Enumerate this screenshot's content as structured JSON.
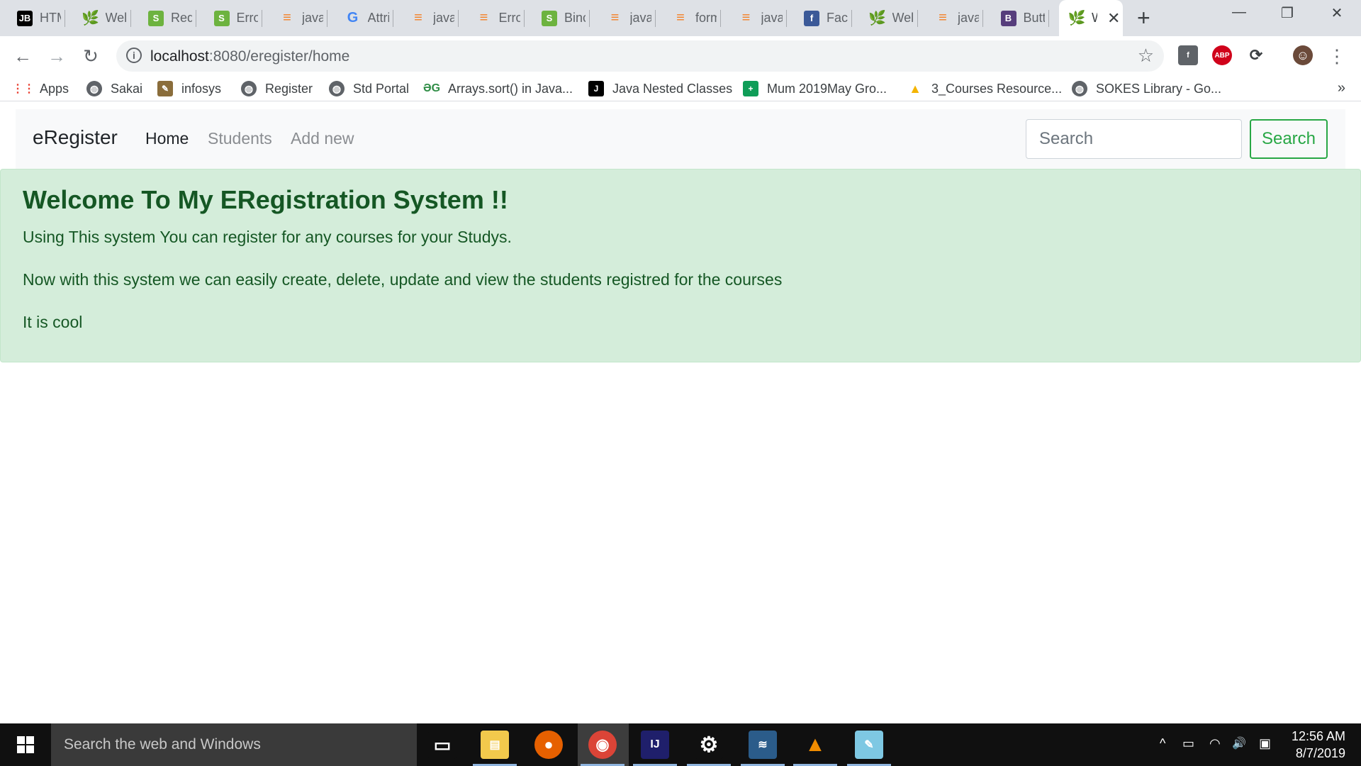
{
  "browser": {
    "tabs": [
      {
        "title": "HTML",
        "icon": "jetbrains-icon",
        "color": "#000000",
        "glyph": "JB"
      },
      {
        "title": "Wel",
        "icon": "spring-leaf-icon",
        "color": "#6db33f",
        "glyph": "🌿"
      },
      {
        "title": "Req",
        "icon": "spring-boot-icon",
        "color": "#6db33f",
        "glyph": "S"
      },
      {
        "title": "Erro",
        "icon": "spring-boot-icon",
        "color": "#6db33f",
        "glyph": "S"
      },
      {
        "title": "java",
        "icon": "stackoverflow-icon",
        "color": "#f48024",
        "glyph": "≡"
      },
      {
        "title": "Attri",
        "icon": "google-icon",
        "color": "#4285f4",
        "glyph": "G"
      },
      {
        "title": "java",
        "icon": "stackoverflow-icon",
        "color": "#f48024",
        "glyph": "≡"
      },
      {
        "title": "Erro",
        "icon": "stackoverflow-icon",
        "color": "#f48024",
        "glyph": "≡"
      },
      {
        "title": "Binc",
        "icon": "spring-boot-icon",
        "color": "#6db33f",
        "glyph": "S"
      },
      {
        "title": "java",
        "icon": "stackoverflow-icon",
        "color": "#f48024",
        "glyph": "≡"
      },
      {
        "title": "form",
        "icon": "stackoverflow-icon",
        "color": "#f48024",
        "glyph": "≡"
      },
      {
        "title": "java",
        "icon": "stackoverflow-icon",
        "color": "#f48024",
        "glyph": "≡"
      },
      {
        "title": "Face",
        "icon": "facebook-icon",
        "color": "#3b5998",
        "glyph": "f"
      },
      {
        "title": "Wel",
        "icon": "spring-leaf-icon",
        "color": "#6db33f",
        "glyph": "🌿"
      },
      {
        "title": "java",
        "icon": "stackoverflow-icon",
        "color": "#f48024",
        "glyph": "≡"
      },
      {
        "title": "Butt",
        "icon": "bootstrap-icon",
        "color": "#563d7c",
        "glyph": "B"
      }
    ],
    "active_tab": {
      "title": "W",
      "icon": "spring-leaf-icon",
      "color": "#6db33f",
      "glyph": "🌿",
      "close": "✕"
    },
    "new_tab": "+",
    "window": {
      "minimize": "—",
      "restore": "❐",
      "close": "✕"
    },
    "address": {
      "host": "localhost",
      "rest": ":8080/eregister/home",
      "info": "i",
      "star": "☆"
    },
    "nav": {
      "back": "←",
      "forward": "→",
      "reload": "↻",
      "menu": "⋮"
    },
    "extensions": [
      {
        "name": "facebook-extension-icon",
        "glyph": "f",
        "color": "#5f6368"
      },
      {
        "name": "adblock-plus-icon",
        "glyph": "ABP",
        "color": "#d0021b"
      },
      {
        "name": "sync-extension-icon",
        "glyph": "⟳",
        "color": "#3c4043"
      },
      {
        "name": "profile-avatar",
        "glyph": "☺",
        "color": "#6b4a3a"
      }
    ],
    "bookmarks": [
      {
        "label": "Apps",
        "icon": "apps-grid-icon",
        "color": "#4285f4",
        "glyph": "⋮⋮"
      },
      {
        "label": "Sakai",
        "icon": "globe-icon",
        "color": "#5f6368",
        "glyph": "◍"
      },
      {
        "label": "infosys",
        "icon": "infosys-icon",
        "color": "#8a6d3b",
        "glyph": "✎"
      },
      {
        "label": "Register",
        "icon": "globe-icon",
        "color": "#5f6368",
        "glyph": "◍"
      },
      {
        "label": "Std Portal",
        "icon": "globe-icon",
        "color": "#5f6368",
        "glyph": "◍"
      },
      {
        "label": "Arrays.sort() in Java...",
        "icon": "geeksforgeeks-icon",
        "color": "#2f8d46",
        "glyph": "ƏG"
      },
      {
        "label": "Java Nested Classes",
        "icon": "journaldev-icon",
        "color": "#000000",
        "glyph": "J"
      },
      {
        "label": "Mum 2019May Gro...",
        "icon": "sheets-icon",
        "color": "#0f9d58",
        "glyph": "+"
      },
      {
        "label": "3_Courses Resource...",
        "icon": "google-drive-icon",
        "color": "#f4b400",
        "glyph": "▲"
      },
      {
        "label": "SOKES Library - Go...",
        "icon": "globe-icon",
        "color": "#5f6368",
        "glyph": "◍"
      }
    ],
    "bookmarks_more": "»"
  },
  "navbar": {
    "brand": "eRegister",
    "links": [
      "Home",
      "Students",
      "Add new"
    ],
    "search_placeholder": "Search",
    "search_button": "Search"
  },
  "alert": {
    "heading": "Welcome To My ERegistration System !!",
    "lines": [
      "Using This system You can register for any courses for your Studys.",
      "Now with this system we can easily create, delete, update and view the students registred for the courses",
      "It is cool"
    ]
  },
  "taskbar": {
    "search_placeholder": "Search the web and Windows",
    "apps": [
      {
        "name": "task-view-icon",
        "glyph": "▭",
        "color": "#101010"
      },
      {
        "name": "file-explorer-icon",
        "glyph": "▤",
        "color": "#f2c94c"
      },
      {
        "name": "firefox-icon",
        "glyph": "●",
        "color": "#e66000"
      },
      {
        "name": "chrome-icon",
        "glyph": "◉",
        "color": "#db4437"
      },
      {
        "name": "intellij-icon",
        "glyph": "IJ",
        "color": "#1f1f6b"
      },
      {
        "name": "settings-gear-icon",
        "glyph": "⚙",
        "color": "#101010"
      },
      {
        "name": "mysql-workbench-icon",
        "glyph": "≋",
        "color": "#2b5c8a"
      },
      {
        "name": "vlc-icon",
        "glyph": "▲",
        "color": "#f08c00"
      },
      {
        "name": "notepad-icon",
        "glyph": "✎",
        "color": "#7ec8e3"
      }
    ],
    "tray": {
      "chevron": "^",
      "battery": "▭",
      "wifi": "◠",
      "volume": "🔊",
      "notifications": "▣"
    },
    "time": "12:56 AM",
    "date": "8/7/2019"
  }
}
